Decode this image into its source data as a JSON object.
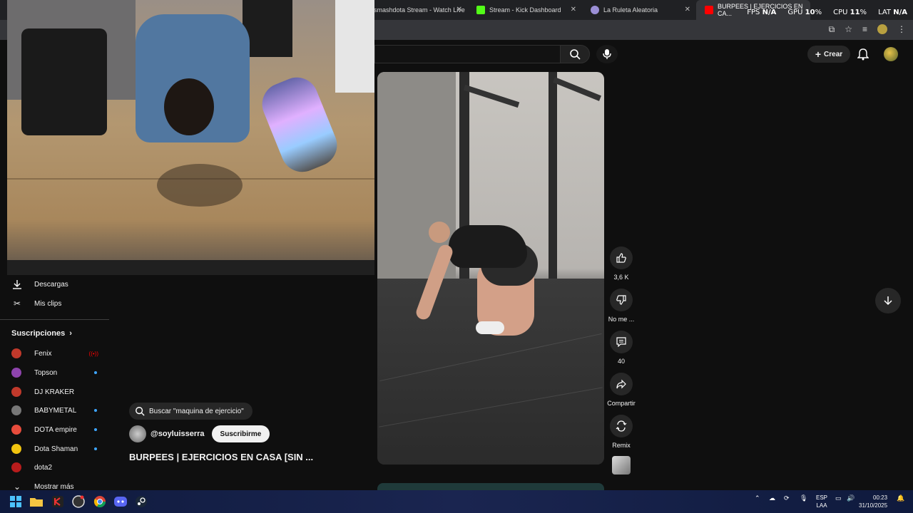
{
  "browser": {
    "tabs": [
      {
        "title": "smashdota Stream - Watch Live",
        "favicon_color": "#3a3a3a"
      },
      {
        "title": "Stream - Kick Dashboard",
        "favicon_color": "#53fc18"
      },
      {
        "title": "La Ruleta Aleatoria",
        "favicon_color": "#9b8fd6"
      },
      {
        "title": "BURPEES | EJERCICIOS EN CA...",
        "favicon_color": "#ff0000"
      }
    ],
    "close_glyph": "✕"
  },
  "overlay": {
    "fps_label": "FPS",
    "fps_value": "N/A",
    "gpu_label": "GPU",
    "gpu_value": "10",
    "cpu_label": "CPU",
    "cpu_value": "11",
    "lat_label": "LAT",
    "lat_value": "N/A",
    "percent": "%"
  },
  "header": {
    "create_label": "Crear"
  },
  "sidebar": {
    "items": [
      {
        "label": "Descargas",
        "icon": "download-icon"
      },
      {
        "label": "Mis clips",
        "icon": "scissors-icon"
      }
    ],
    "subscriptions_title": "Suscripciones",
    "subscriptions": [
      {
        "name": "Fenix",
        "color": "#c0392b",
        "status": "live"
      },
      {
        "name": "Topson",
        "color": "#8e44ad",
        "status": "new"
      },
      {
        "name": "DJ KRAKER",
        "color": "#c0392b",
        "status": ""
      },
      {
        "name": "BABYMETAL",
        "color": "#777777",
        "status": "new"
      },
      {
        "name": "DOTA empire",
        "color": "#e74c3c",
        "status": "new"
      },
      {
        "name": "Dota Shaman",
        "color": "#f1c40f",
        "status": "new"
      },
      {
        "name": "dota2",
        "color": "#b71c1c",
        "status": ""
      }
    ],
    "show_more": "Mostrar más"
  },
  "short": {
    "search_suggestion": "Buscar \"maquina de ejercicio\"",
    "channel": "@soyluisserra",
    "subscribe_label": "Suscribirme",
    "title": "BURPEES | EJERCICIOS EN CASA [SIN ..."
  },
  "actions": {
    "like_count": "3,6 K",
    "dislike_label": "No me ...",
    "comments_count": "40",
    "share_label": "Compartir",
    "remix_label": "Remix"
  },
  "taskbar": {
    "lang_top": "ESP",
    "lang_bottom": "LAA",
    "time": "00:23",
    "date": "31/10/2025"
  }
}
